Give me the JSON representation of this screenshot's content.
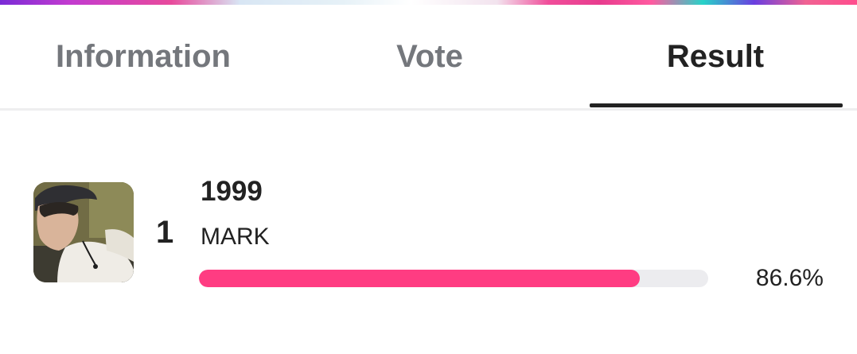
{
  "tabs": [
    {
      "label": "Information",
      "active": false
    },
    {
      "label": "Vote",
      "active": false
    },
    {
      "label": "Result",
      "active": true
    }
  ],
  "result": {
    "rank": "1",
    "title": "1999",
    "artist": "MARK",
    "percent_label": "86.6%",
    "percent_value": 86.6,
    "thumbnail_caption": "MARK"
  },
  "colors": {
    "accent": "#ff3c82",
    "track": "#ececef",
    "active_text": "#222222",
    "inactive_text": "#74777c"
  }
}
